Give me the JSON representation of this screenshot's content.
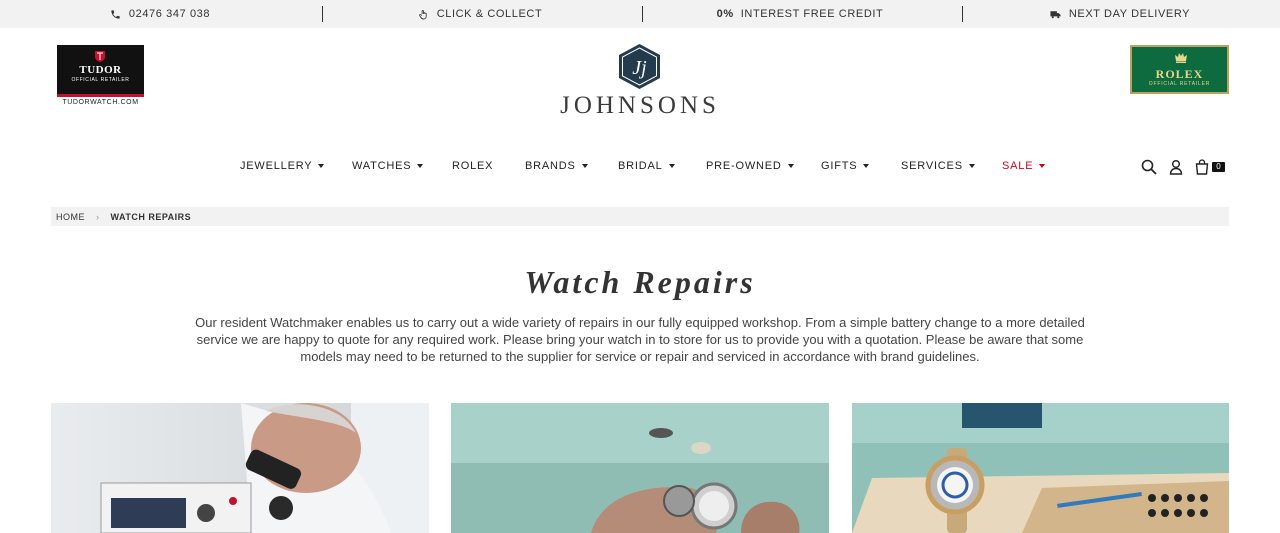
{
  "topbar": {
    "phone": "02476 347 038",
    "click_collect": "CLICK & COLLECT",
    "credit_strong": "0%",
    "credit": "INTEREST FREE CREDIT",
    "delivery": "NEXT DAY DELIVERY"
  },
  "header": {
    "tudor_brand": "TUDOR",
    "tudor_sub": "OFFICIAL RETAILER",
    "tudor_url": "TUDORWATCH.COM",
    "logo_text": "JOHNSONS",
    "rolex_brand": "ROLEX",
    "rolex_sub": "OFFICIAL RETAILER"
  },
  "nav": {
    "items": [
      {
        "label": "JEWELLERY"
      },
      {
        "label": "WATCHES"
      },
      {
        "label": "ROLEX"
      },
      {
        "label": "BRANDS"
      },
      {
        "label": "BRIDAL"
      },
      {
        "label": "PRE-OWNED"
      },
      {
        "label": "GIFTS"
      },
      {
        "label": "SERVICES"
      },
      {
        "label": "SALE"
      }
    ],
    "cart_count": "0"
  },
  "breadcrumb": {
    "home": "HOME",
    "current": "WATCH REPAIRS"
  },
  "main": {
    "title": "Watch Repairs",
    "intro": "Our resident Watchmaker enables us to carry out a wide variety of repairs in our fully equipped workshop. From a simple battery change to a more detailed service we are happy to quote for any required work. Please bring your watch in to store for us to provide you with a quotation. Please be aware that some models may need to be returned to the supplier for service or repair and serviced in accordance with brand guidelines."
  },
  "colors": {
    "sale": "#d0021b",
    "rolex_green": "#0e6b3f",
    "tudor_red": "#c8102e",
    "topbar_bg": "#f2f2f2"
  }
}
